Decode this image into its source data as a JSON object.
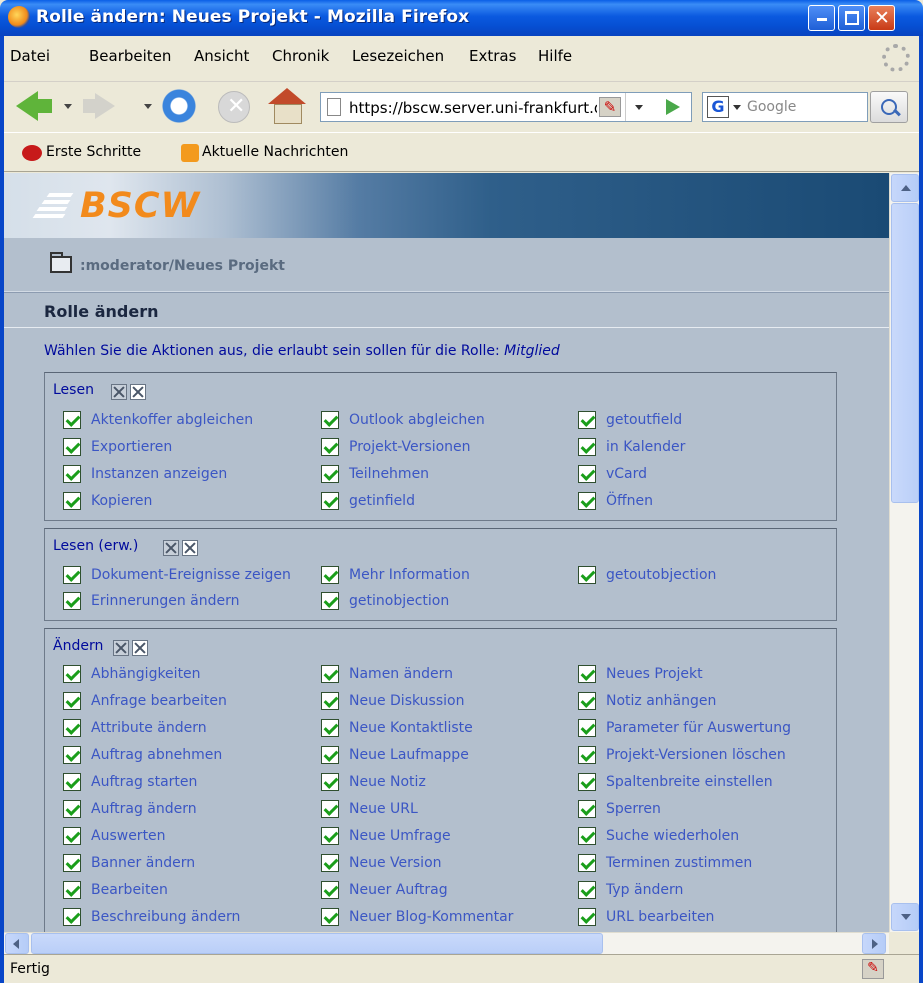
{
  "window": {
    "title": "Rolle ändern: Neues Projekt - Mozilla Firefox"
  },
  "menu": [
    "Datei",
    "Bearbeiten",
    "Ansicht",
    "Chronik",
    "Lesezeichen",
    "Extras",
    "Hilfe"
  ],
  "nav": {
    "url": "https://bscw.server.uni-frankfurt.de",
    "search_placeholder": "Google"
  },
  "bookmarks": [
    "Erste Schritte",
    "Aktuelle Nachrichten"
  ],
  "page": {
    "logo": "BSCW",
    "breadcrumb": ":moderator/Neues Projekt",
    "section_title": "Rolle ändern",
    "prompt_text": "Wählen Sie die Aktionen aus, die erlaubt sein sollen für die Rolle: ",
    "role_name": "Mitglied"
  },
  "groups": [
    {
      "title": "Lesen",
      "items": [
        "Aktenkoffer abgleichen",
        "Outlook abgleichen",
        "getoutfield",
        "Exportieren",
        "Projekt-Versionen",
        "in Kalender",
        "Instanzen anzeigen",
        "Teilnehmen",
        "vCard",
        "Kopieren",
        "getinfield",
        "Öffnen"
      ]
    },
    {
      "title": "Lesen (erw.)",
      "items": [
        "Dokument-Ereignisse zeigen",
        "Mehr Information",
        "getoutobjection",
        "Erinnerungen ändern",
        "getinobjection"
      ]
    },
    {
      "title": "Ändern",
      "items": [
        "Abhängigkeiten",
        "Namen ändern",
        "Neues Projekt",
        "Anfrage bearbeiten",
        "Neue Diskussion",
        "Notiz anhängen",
        "Attribute ändern",
        "Neue Kontaktliste",
        "Parameter für Auswertung",
        "Auftrag abnehmen",
        "Neue Laufmappe",
        "Projekt-Versionen löschen",
        "Auftrag starten",
        "Neue Notiz",
        "Spaltenbreite einstellen",
        "Auftrag ändern",
        "Neue URL",
        "Sperren",
        "Auswerten",
        "Neue Umfrage",
        "Suche wiederholen",
        "Banner ändern",
        "Neue Version",
        "Terminen zustimmen",
        "Bearbeiten",
        "Neuer Auftrag",
        "Typ ändern",
        "Beschreibung ändern",
        "Neuer Blog-Kommentar",
        "URL bearbeiten"
      ]
    }
  ],
  "status": {
    "text": "Fertig"
  }
}
